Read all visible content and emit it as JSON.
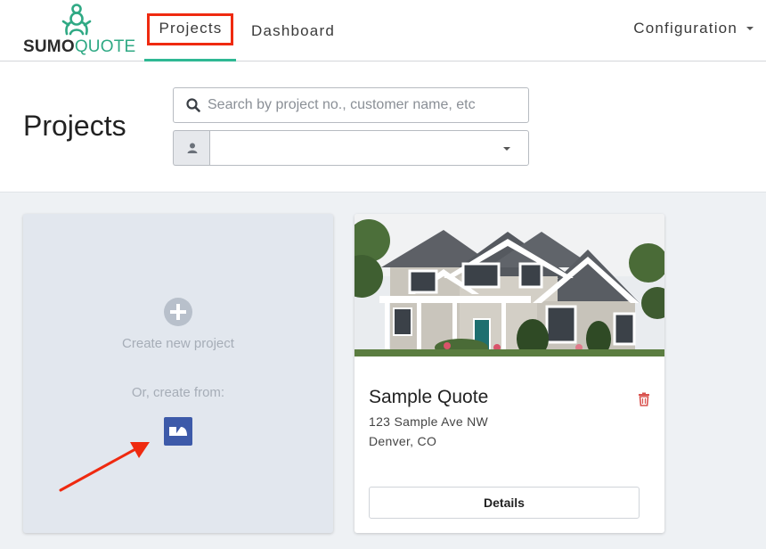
{
  "brand": {
    "name_part1": "SUMO",
    "name_part2": "QUOTE",
    "accent_color": "#2fa984",
    "logo_icon": "sumo-wrestler-icon"
  },
  "nav": {
    "projects": "Projects",
    "dashboard": "Dashboard",
    "configuration": "Configuration"
  },
  "header": {
    "title": "Projects",
    "search_placeholder": "Search by project no., customer name, etc",
    "search_value": "",
    "user_filter_value": ""
  },
  "new_project": {
    "create_label": "Create new project",
    "or_label": "Or, create from:"
  },
  "projects": [
    {
      "title": "Sample Quote",
      "address_line1": "123 Sample Ave NW",
      "address_line2": "Denver, CO",
      "details_label": "Details"
    }
  ],
  "colors": {
    "highlight": "#ef2a10",
    "active_tab": "#2fb894",
    "delete": "#d9534f",
    "template_icon": "#3d5aa9"
  }
}
